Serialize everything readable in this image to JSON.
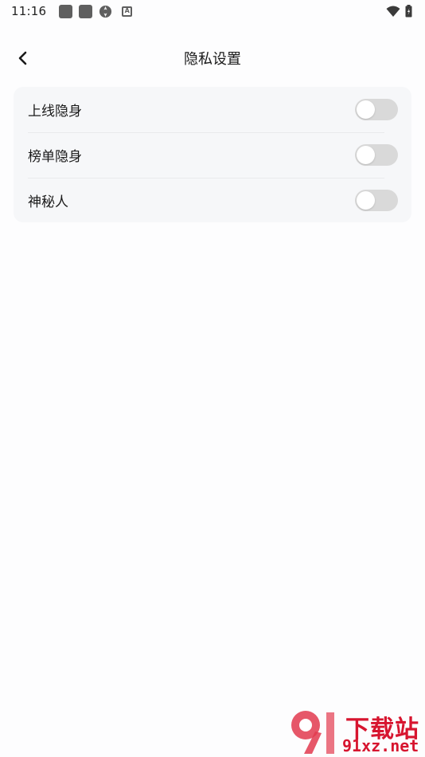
{
  "status_bar": {
    "time": "11:16",
    "icons": [
      "app-icon",
      "app-icon",
      "aperture-icon",
      "a-icon",
      "wifi-icon",
      "battery-icon"
    ]
  },
  "header": {
    "title": "隐私设置",
    "back_icon": "chevron-left-icon"
  },
  "settings": {
    "items": [
      {
        "label": "上线隐身",
        "enabled": false
      },
      {
        "label": "榜单隐身",
        "enabled": false
      },
      {
        "label": "神秘人",
        "enabled": false
      }
    ]
  },
  "watermark": {
    "title": "下载站",
    "url": "91xz.net",
    "logo_text": "91"
  },
  "colors": {
    "card_bg": "#f6f7f9",
    "toggle_off": "#d9d9d9",
    "watermark": "#d7152f"
  }
}
